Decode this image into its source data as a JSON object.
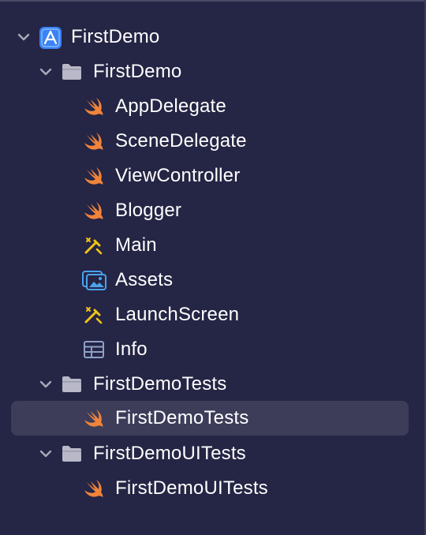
{
  "navigator": {
    "items": [
      {
        "label": "FirstDemo",
        "icon": "app-project-icon",
        "level": 0,
        "expandable": true,
        "expanded": true
      },
      {
        "label": "FirstDemo",
        "icon": "folder-icon",
        "level": 1,
        "expandable": true,
        "expanded": true
      },
      {
        "label": "AppDelegate",
        "icon": "swift-icon",
        "level": 2
      },
      {
        "label": "SceneDelegate",
        "icon": "swift-icon",
        "level": 2
      },
      {
        "label": "ViewController",
        "icon": "swift-icon",
        "level": 2
      },
      {
        "label": "Blogger",
        "icon": "swift-icon",
        "level": 2
      },
      {
        "label": "Main",
        "icon": "storyboard-icon",
        "level": 2
      },
      {
        "label": "Assets",
        "icon": "asset-catalog-icon",
        "level": 2
      },
      {
        "label": "LaunchScreen",
        "icon": "storyboard-icon",
        "level": 2
      },
      {
        "label": "Info",
        "icon": "plist-icon",
        "level": 2
      },
      {
        "label": "FirstDemoTests",
        "icon": "folder-icon",
        "level": 1,
        "expandable": true,
        "expanded": true
      },
      {
        "label": "FirstDemoTests",
        "icon": "swift-icon",
        "level": 2,
        "selected": true
      },
      {
        "label": "FirstDemoUITests",
        "icon": "folder-icon",
        "level": 1,
        "expandable": true,
        "expanded": true
      },
      {
        "label": "FirstDemoUITests",
        "icon": "swift-icon",
        "level": 2
      }
    ]
  },
  "colors": {
    "background": "#252545",
    "selection": "#3d3d5a",
    "text": "#ffffff",
    "chevron": "#a8a8bc",
    "folder": "#b8b8c8",
    "swift": "#f0843a",
    "app_icon": "#3b82f6",
    "storyboard": "#f0c419",
    "assets": "#4aa3ec",
    "plist": "#8fa0c8"
  }
}
